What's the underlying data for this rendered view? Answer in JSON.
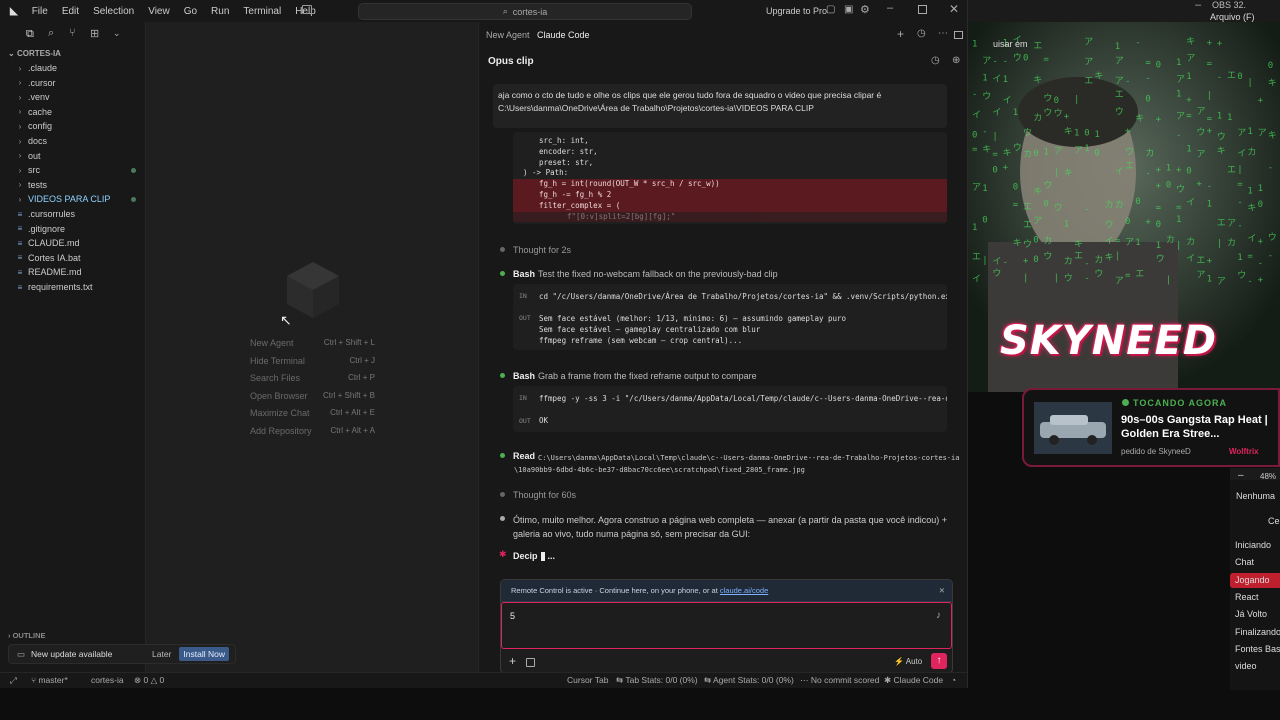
{
  "titlebar": {
    "menus": [
      "File",
      "Edit",
      "Selection",
      "View",
      "Go",
      "Run",
      "Terminal",
      "Help"
    ],
    "search": "cortes-ia",
    "upgrade": "Upgrade to Pro"
  },
  "explorer": {
    "root": "CORTES-IA",
    "items": [
      {
        "label": ".claude",
        "folder": true
      },
      {
        "label": ".cursor",
        "folder": true
      },
      {
        "label": ".venv",
        "folder": true
      },
      {
        "label": "cache",
        "folder": true
      },
      {
        "label": "config",
        "folder": true
      },
      {
        "label": "docs",
        "folder": true
      },
      {
        "label": "out",
        "folder": true
      },
      {
        "label": "src",
        "folder": true,
        "modified": true
      },
      {
        "label": "tests",
        "folder": true
      },
      {
        "label": "VIDEOS PARA CLIP",
        "folder": true,
        "modified": true,
        "highlight": true
      },
      {
        "label": ".cursorrules",
        "folder": false
      },
      {
        "label": ".gitignore",
        "folder": false
      },
      {
        "label": "CLAUDE.md",
        "folder": false
      },
      {
        "label": "Cortes IA.bat",
        "folder": false
      },
      {
        "label": "README.md",
        "folder": false
      },
      {
        "label": "requirements.txt",
        "folder": false
      }
    ],
    "outline": "OUTLINE"
  },
  "update": {
    "text": "New update available",
    "later": "Later",
    "install": "Install Now"
  },
  "shortcuts": [
    {
      "label": "New Agent",
      "keys": "Ctrl + Shift + L"
    },
    {
      "label": "Hide Terminal",
      "keys": "Ctrl + J"
    },
    {
      "label": "Search Files",
      "keys": "Ctrl + P"
    },
    {
      "label": "Open Browser",
      "keys": "Ctrl + Shift + B"
    },
    {
      "label": "Maximize Chat",
      "keys": "Ctrl + Alt + E"
    },
    {
      "label": "Add Repository",
      "keys": "Ctrl + Alt + A"
    }
  ],
  "agent": {
    "tabs": [
      "New Agent",
      "Claude Code"
    ],
    "title": "Opus clip",
    "prompt_line1": "aja como o cto de tudo e olhe os clips que ele gerou tudo fora de squadro o video que precisa clipar é",
    "prompt_line2": "C:\\Users\\danma\\OneDrive\\Área de Trabalho\\Projetos\\cortes-ia\\VIDEOS PARA CLIP",
    "code": [
      "src_h: int,",
      "encoder: str,",
      "preset: str,",
      ") -> Path:",
      "fg_h = int(round(OUT_W * src_h / src_w))",
      "fg_h -= fg_h % 2",
      "filter_complex = (",
      "f\"[0:v]split=2[bg][fg];\""
    ],
    "thought1": "Thought for 2s",
    "bash1": {
      "tag": "Bash",
      "desc": "Test the fixed no-webcam fallback on the previously-bad clip",
      "in_label": "IN",
      "in": "cd \"/c/Users/danma/OneDrive/Área de Trabalho/Projetos/cortes-ia\" && .venv/Scripts/python.exe -m py_c",
      "out_label": "OUT",
      "out": [
        "Sem face estável (melhor: 1/13, mínimo: 6) — assumindo gameplay puro",
        "Sem face estável — gameplay centralizado com blur",
        "ffmpeg reframe (sem webcam — crop central)..."
      ]
    },
    "bash2": {
      "tag": "Bash",
      "desc": "Grab a frame from the fixed reframe output to compare",
      "in_label": "IN",
      "in": "ffmpeg -y -ss 3 -i \"/c/Users/danma/AppData/Local/Temp/claude/c--Users-danma-OneDrive--rea-de-Trabalh",
      "out_label": "OUT",
      "out": [
        "OK"
      ]
    },
    "read": {
      "tag": "Read",
      "line1": "C:\\Users\\danma\\AppData\\Local\\Temp\\claude\\c--Users-danma-OneDrive--rea-de-Trabalho-Projetos-cortes-ia",
      "line2": "\\10a90bb9-6dbd-4b6c-be37-d8bac70cc6ee\\scratchpad\\fixed_2805_frame.jpg"
    },
    "thought2": "Thought for 60s",
    "reply1": "Ótimo, muito melhor. Agora construo a página web completa — anexar (a partir da pasta que você indicou) +",
    "reply2": "galeria ao vivo, tudo numa página só, sem precisar da GUI:",
    "working": "Decip",
    "working_dots": "...",
    "remote_text": "Remote Control is active · Continue here, on your phone, or at ",
    "remote_link": "claude.ai/code",
    "input_value": "5",
    "mode": "Auto"
  },
  "status": {
    "branch": "master*",
    "folder": "cortes-ia",
    "errors": "0",
    "warnings": "0",
    "items": [
      "Cursor Tab",
      "Tab Stats: 0/0 (0%)",
      "Agent Stats: 0/0 (0%)",
      "No commit scored",
      "Claude Code"
    ]
  },
  "overlay": {
    "channel": "SKYNEED",
    "now_playing": "TOCANDO AGORA",
    "song": "90s–00s Gangsta Rap Heat | Golden Era Stree...",
    "requested": "pedido de SkyneeD",
    "requester": "Wolftrix"
  },
  "obs": {
    "top": "OBS 32.",
    "arquivo": "Arquivo (F)",
    "uisar": "uisar em",
    "zoom": "48%",
    "nenhuma": "Nenhuma",
    "cen": "Cen",
    "scenes": [
      "Iniciando",
      "Chat",
      "Jogando",
      "React",
      "Já Volto",
      "Finalizando",
      "Fontes Base",
      "video"
    ],
    "active": "Jogando"
  },
  "colors": {
    "accent": "#e0245e",
    "green": "#4caf50",
    "red_diff": "#5a1a1f"
  }
}
